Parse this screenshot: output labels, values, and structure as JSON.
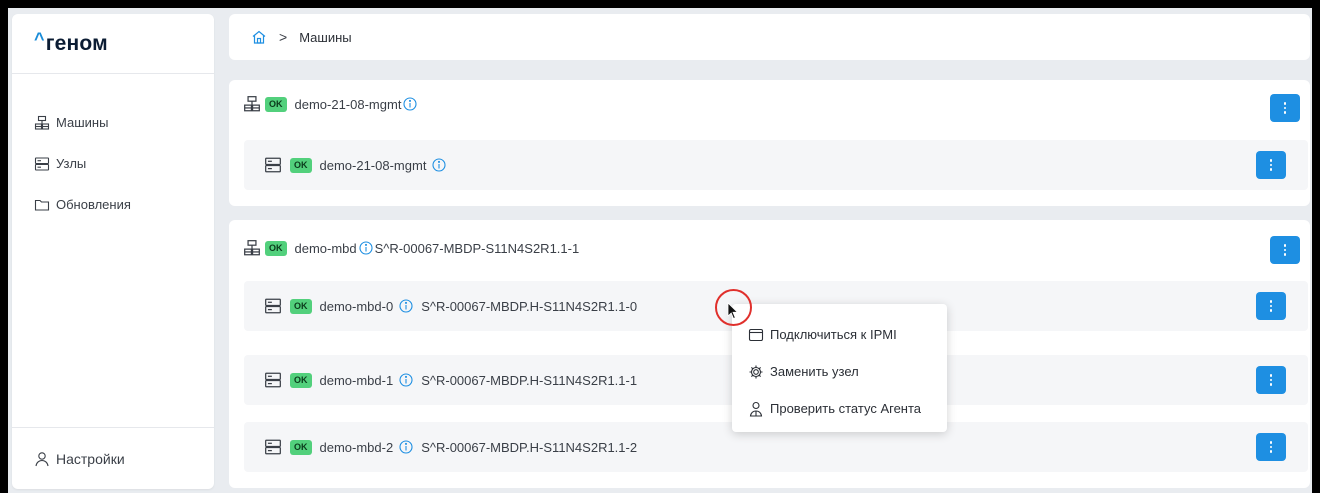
{
  "brand": {
    "caret": "^",
    "name": "геном"
  },
  "sidebar": {
    "items": [
      {
        "label": "Машины",
        "icon": "machines-icon"
      },
      {
        "label": "Узлы",
        "icon": "nodes-icon"
      },
      {
        "label": "Обновления",
        "icon": "folder-icon"
      }
    ],
    "settings_label": "Настройки"
  },
  "breadcrumb": {
    "home_icon": "home-icon",
    "separator": ">",
    "current": "Машины"
  },
  "status_ok": "OK",
  "groups": [
    {
      "name": "demo-21-08-mgmt",
      "serial": "",
      "nodes": [
        {
          "name": "demo-21-08-mgmt",
          "serial": ""
        }
      ]
    },
    {
      "name": "demo-mbd",
      "serial": "S^R-00067-MBDP-S11N4S2R1.1-1",
      "nodes": [
        {
          "name": "demo-mbd-0",
          "serial": "S^R-00067-MBDP.H-S11N4S2R1.1-0"
        },
        {
          "name": "demo-mbd-1",
          "serial": "S^R-00067-MBDP.H-S11N4S2R1.1-1"
        },
        {
          "name": "demo-mbd-2",
          "serial": "S^R-00067-MBDP.H-S11N4S2R1.1-2"
        }
      ]
    }
  ],
  "context_menu": {
    "items": [
      {
        "label": "Подключиться к IPMI",
        "icon": "ipmi-window-icon"
      },
      {
        "label": "Заменить узел",
        "icon": "gear-icon"
      },
      {
        "label": "Проверить статус Агента",
        "icon": "agent-icon"
      }
    ]
  },
  "colors": {
    "accent": "#1e8fe2",
    "ok_badge": "#52d07c",
    "brand_caret": "#1a8cd8",
    "cursor_ring": "#e0302c"
  }
}
